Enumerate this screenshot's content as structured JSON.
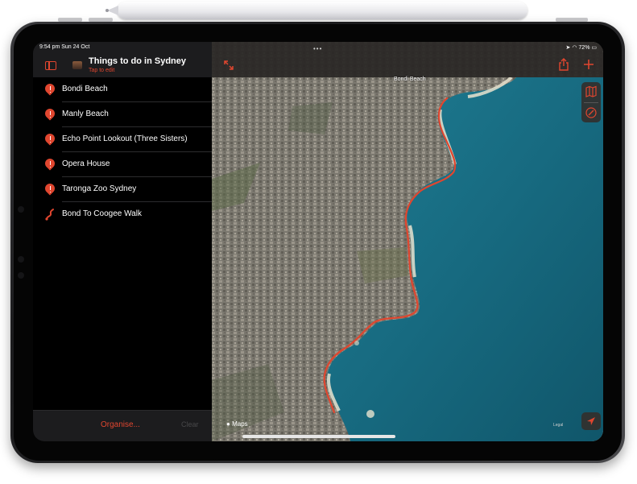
{
  "status_bar": {
    "time_date": "9:54 pm  Sun 24 Oct",
    "battery": "72%",
    "multitask_dots": "•••"
  },
  "guide": {
    "title": "Things to do in Sydney",
    "subtitle": "Tap to edit"
  },
  "places": [
    {
      "label": "Bondi Beach",
      "icon": "pin-icon"
    },
    {
      "label": "Manly Beach",
      "icon": "pin-icon"
    },
    {
      "label": "Echo Point Lookout (Three Sisters)",
      "icon": "pin-icon"
    },
    {
      "label": "Opera House",
      "icon": "pin-icon"
    },
    {
      "label": "Taronga Zoo Sydney",
      "icon": "pin-icon"
    },
    {
      "label": "Bond To Coogee Walk",
      "icon": "route-icon"
    }
  ],
  "footer": {
    "organise_label": "Organise...",
    "clear_label": "Clear"
  },
  "map": {
    "place_label": "Bondi Beach",
    "brand": "Maps",
    "legal": "Legal"
  },
  "colors": {
    "accent": "#e0462f",
    "sidebar_bg": "#000000",
    "header_bg": "#1c1c1e",
    "ocean": "#1b6f86",
    "route": "#e0462f"
  }
}
